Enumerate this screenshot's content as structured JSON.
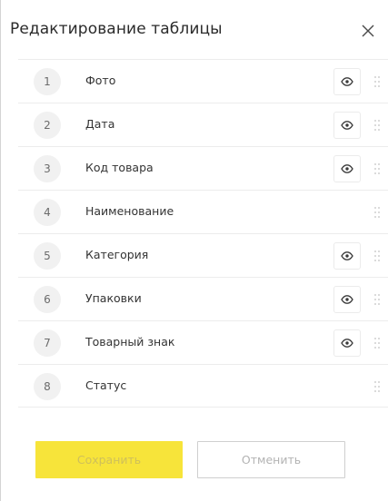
{
  "dialog": {
    "title": "Редактирование таблицы",
    "close_icon": "close-icon"
  },
  "columns": [
    {
      "number": "1",
      "label": "Фото",
      "visibility_toggle": true
    },
    {
      "number": "2",
      "label": "Дата",
      "visibility_toggle": true
    },
    {
      "number": "3",
      "label": "Код товара",
      "visibility_toggle": true
    },
    {
      "number": "4",
      "label": "Наименование",
      "visibility_toggle": false
    },
    {
      "number": "5",
      "label": "Категория",
      "visibility_toggle": true
    },
    {
      "number": "6",
      "label": "Упаковки",
      "visibility_toggle": true
    },
    {
      "number": "7",
      "label": "Товарный знак",
      "visibility_toggle": true
    },
    {
      "number": "8",
      "label": "Статус",
      "visibility_toggle": false
    }
  ],
  "icons": {
    "visibility": "eye-icon",
    "reorder": "drag-handle-icon"
  },
  "footer": {
    "save_label": "Сохранить",
    "cancel_label": "Отменить"
  },
  "colors": {
    "save_button_bg": "#f7e43a",
    "save_button_text": "#cfc05a",
    "cancel_button_border": "#cfcfcf",
    "cancel_button_text": "#b3b3b3"
  }
}
